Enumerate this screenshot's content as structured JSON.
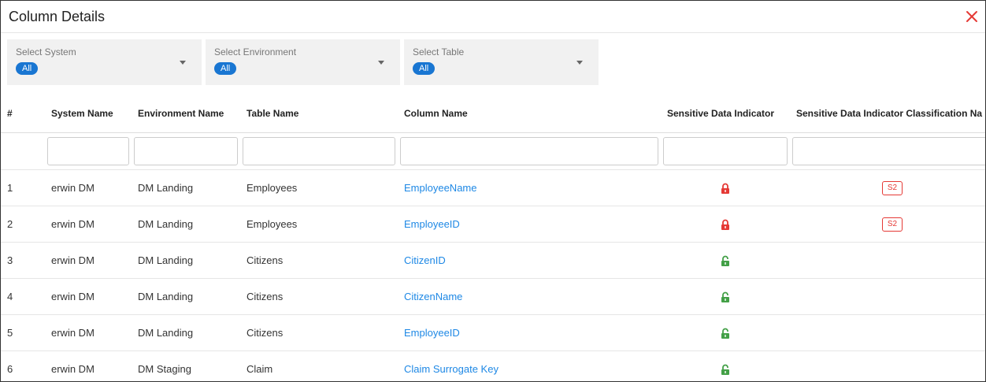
{
  "dialog": {
    "title": "Column Details"
  },
  "filters": [
    {
      "label": "Select System",
      "value": "All"
    },
    {
      "label": "Select Environment",
      "value": "All"
    },
    {
      "label": "Select Table",
      "value": "All"
    }
  ],
  "table": {
    "headers": [
      "#",
      "System Name",
      "Environment Name",
      "Table Name",
      "Column Name",
      "Sensitive Data Indicator",
      "Sensitive Data Indicator Classification Na"
    ],
    "rows": [
      {
        "num": "1",
        "system": "erwin DM",
        "environment": "DM Landing",
        "table": "Employees",
        "column": "EmployeeName",
        "sensitive": true,
        "classification": "S2"
      },
      {
        "num": "2",
        "system": "erwin DM",
        "environment": "DM Landing",
        "table": "Employees",
        "column": "EmployeeID",
        "sensitive": true,
        "classification": "S2"
      },
      {
        "num": "3",
        "system": "erwin DM",
        "environment": "DM Landing",
        "table": "Citizens",
        "column": "CitizenID",
        "sensitive": false,
        "classification": ""
      },
      {
        "num": "4",
        "system": "erwin DM",
        "environment": "DM Landing",
        "table": "Citizens",
        "column": "CitizenName",
        "sensitive": false,
        "classification": ""
      },
      {
        "num": "5",
        "system": "erwin DM",
        "environment": "DM Landing",
        "table": "Citizens",
        "column": "EmployeeID",
        "sensitive": false,
        "classification": ""
      },
      {
        "num": "6",
        "system": "erwin DM",
        "environment": "DM Staging",
        "table": "Claim",
        "column": "Claim Surrogate Key",
        "sensitive": false,
        "classification": ""
      }
    ]
  },
  "colors": {
    "locked": "#e53935",
    "unlocked": "#43a047",
    "link": "#1e88e5",
    "pill": "#1976d2"
  }
}
